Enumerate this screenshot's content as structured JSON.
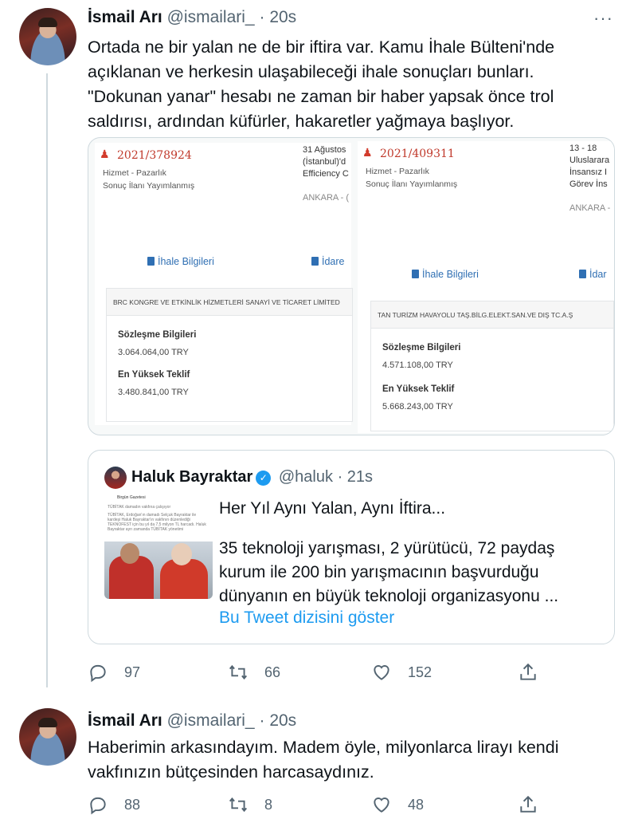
{
  "tweet1": {
    "author_name": "İsmail Arı",
    "author_handle": "@ismailari_",
    "separator": "·",
    "time": "20s",
    "more": "···",
    "lines": [
      "Ortada ne bir yalan ne de bir iftira var. Kamu İhale Bülteni'nde",
      "açıklanan ve herkesin ulaşabileceği ihale sonuçları bunları.",
      "\"Dokunan yanar\" hesabı ne zaman bir haber yapsak önce trol",
      "saldırısı, ardından küfürler, hakaretler yağmaya başlıyor."
    ],
    "docs": [
      {
        "ref": "2021/378924",
        "type": "Hizmet - Pazarlık",
        "status": "Sonuç İlanı Yayımlanmış",
        "right_lines": [
          "31 Ağustos",
          "(İstanbul)'d",
          "Efficiency C",
          "",
          "ANKARA - ("
        ],
        "link1": "İhale Bilgileri",
        "link2": "İdare",
        "company": "BRC KONGRE VE ETKİNLİK HİZMETLERİ SANAYİ VE TİCARET LİMİTED",
        "contract_label": "Sözleşme Bilgileri",
        "contract_value": "3.064.064,00 TRY",
        "offer_label": "En Yüksek Teklif",
        "offer_value": "3.480.841,00 TRY"
      },
      {
        "ref": "2021/409311",
        "type": "Hizmet - Pazarlık",
        "status": "Sonuç İlanı Yayımlanmış",
        "right_lines": [
          "13  -  18",
          "Uluslarara",
          "İnsansız  I",
          "Görev İns",
          "",
          "ANKARA -"
        ],
        "link1": "İhale Bilgileri",
        "link2": "İdar",
        "company": "TAN TURİZM HAVAYOLU TAŞ.BİLG.ELEKT.SAN.VE DIŞ TC.A.Ş",
        "contract_label": "Sözleşme Bilgileri",
        "contract_value": "4.571.108,00 TRY",
        "offer_label": "En Yüksek Teklif",
        "offer_value": "5.668.243,00 TRY"
      }
    ],
    "quote": {
      "author_name": "Haluk Bayraktar",
      "verified_mark": "✓",
      "author_handle": "@haluk",
      "separator": "·",
      "time": "21s",
      "thumb_lines": [
        "Birgün Gazetesi",
        "TÜBİTAK damadın vakfına çalışıyor",
        "TÜBİTAK, Erdoğan'ın damadı Selçuk Bayraktar ile",
        "kardeşi Haluk Bayraktar'ın vakfının düzenlediği",
        "TEKNOFEST için bu yıl da 7,5 milyon TL harcadı. Haluk",
        "Bayraktar ayrı zamanda TÜBİTAK yönetimi"
      ],
      "headline": "Her Yıl Aynı Yalan, Aynı İftira...",
      "body_lines": [
        "35 teknoloji yarışması, 2 yürütücü, 72 paydaş",
        "kurum ile 200 bin yarışmacının başvurduğu",
        "dünyanın en büyük teknoloji organizasyonu ..."
      ],
      "thread_link": "Bu Tweet dizisini göster"
    },
    "actions": {
      "replies": "97",
      "retweets": "66",
      "likes": "152"
    }
  },
  "tweet2": {
    "author_name": "İsmail Arı",
    "author_handle": "@ismailari_",
    "separator": "·",
    "time": "20s",
    "lines": [
      "Haberimin arkasındayım. Madem öyle, milyonlarca lirayı kendi",
      "vakfınızın bütçesinden harcasaydınız."
    ],
    "actions": {
      "replies": "88",
      "retweets": "8",
      "likes": "48"
    }
  },
  "icons": {
    "reply": "reply-icon",
    "retweet": "retweet-icon",
    "like": "heart-icon",
    "share": "share-icon",
    "building": "building-icon",
    "info": "document-icon"
  },
  "colors": {
    "accent": "#1d9bf0",
    "text": "#0f1419",
    "muted": "#536471",
    "border": "#cfd9de",
    "tender_ref": "#c0392b"
  }
}
